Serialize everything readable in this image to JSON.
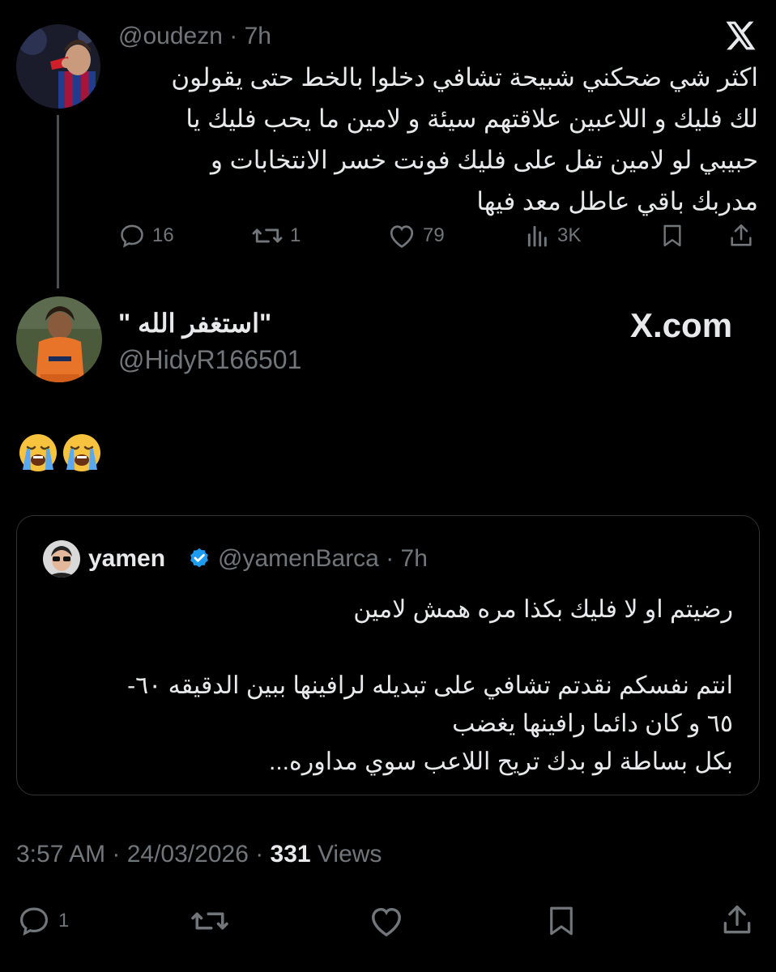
{
  "reply_tweet": {
    "handle": "@oudezn",
    "time": "7h",
    "text_lines": [
      "اكثر شي ضحكني شبيحة تشافي دخلوا بالخط حتى يقولون",
      "لك فليك و اللاعبين علاقتهم سيئة و لامين ما يحب فليك يا",
      "حبيبي لو لامين تفل على فليك فونت خسر الانتخابات و",
      "مدربك باقي عاطل معد فيها"
    ],
    "stats": {
      "replies": "16",
      "reposts": "1",
      "likes": "79",
      "views": "3K"
    }
  },
  "x_icon": "x-logo-icon",
  "brand": {
    "domain": "X.com"
  },
  "main_tweet": {
    "name": "\"استغفر الله \"",
    "handle": "@HidyR166501",
    "emojis": [
      "loudly-crying-face",
      "loudly-crying-face"
    ],
    "quote": {
      "name": "yamen",
      "verified": true,
      "handle": "@yamenBarca",
      "time": "7h",
      "text_lines": [
        "رضيتم او لا فليك بكذا مره همش لامين",
        "",
        "انتم نفسكم نقدتم تشافي على تبديله لرافينها ببين الدقيقه ٦٠-",
        "٦٥ و كان دائما رافينها يغضب",
        "بكل بساطة لو بدك تريح اللاعب سوي مداوره..."
      ]
    },
    "timestamp": "3:57 AM · 24/03/2026 ·",
    "views_count": "331",
    "views_label": "Views",
    "stats": {
      "replies": "1"
    }
  },
  "colors": {
    "background": "#000000",
    "text": "#e7e9ea",
    "muted": "#71767b",
    "verified": "#1d9bf0"
  }
}
